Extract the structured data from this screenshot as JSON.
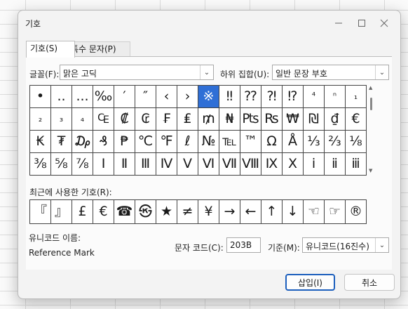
{
  "window": {
    "title": "기호",
    "minimize_icon": "minimize-icon",
    "maximize_icon": "maximize-icon",
    "close_icon": "close-icon"
  },
  "tabs": [
    {
      "label": "기호(S)"
    },
    {
      "label": "특수 문자(P)"
    }
  ],
  "font": {
    "label": "글꼴(F):",
    "value": "맑은 고딕"
  },
  "subset": {
    "label": "하위 집합(U):",
    "value": "일반 문장 부호"
  },
  "symbols": [
    [
      "•",
      "..",
      "...",
      "‰",
      "′",
      "″",
      "‹",
      "›",
      "※",
      "‼",
      "⁇",
      "⁈",
      "⁉",
      "⁴",
      "ⁿ",
      "₁"
    ],
    [
      "₂",
      "₃",
      "₄",
      "₠",
      "₡",
      "₢",
      "₣",
      "₤",
      "₥",
      "₦",
      "₧",
      "₨",
      "₩",
      "₪",
      "₫",
      "€"
    ],
    [
      "₭",
      "₮",
      "₯",
      "₰",
      "₱",
      "℃",
      "℉",
      "ℓ",
      "№",
      "℡",
      "™",
      "Ω",
      "Å",
      "⅓",
      "⅔",
      "⅛"
    ],
    [
      "⅜",
      "⅝",
      "⅞",
      "Ⅰ",
      "Ⅱ",
      "Ⅲ",
      "Ⅳ",
      "Ⅴ",
      "Ⅵ",
      "Ⅶ",
      "Ⅷ",
      "Ⅸ",
      "Ⅹ",
      "ⅰ",
      "ⅱ",
      "ⅲ"
    ]
  ],
  "recent": {
    "label": "최근에 사용한 기호(R):",
    "items": [
      "『",
      "』",
      "£",
      "€",
      "☎",
      "㉿",
      "★",
      "≠",
      "¥",
      "→",
      "←",
      "↑",
      "↓",
      "☜",
      "☞",
      "®"
    ]
  },
  "unicode_name": {
    "label": "유니코드 이름:",
    "value": "Reference Mark"
  },
  "char_code": {
    "label": "문자 코드(C):",
    "value": "203B"
  },
  "from": {
    "label": "기준(M):",
    "value": "유니코드(16진수)"
  },
  "buttons": {
    "insert": "삽입(I)",
    "cancel": "취소"
  }
}
